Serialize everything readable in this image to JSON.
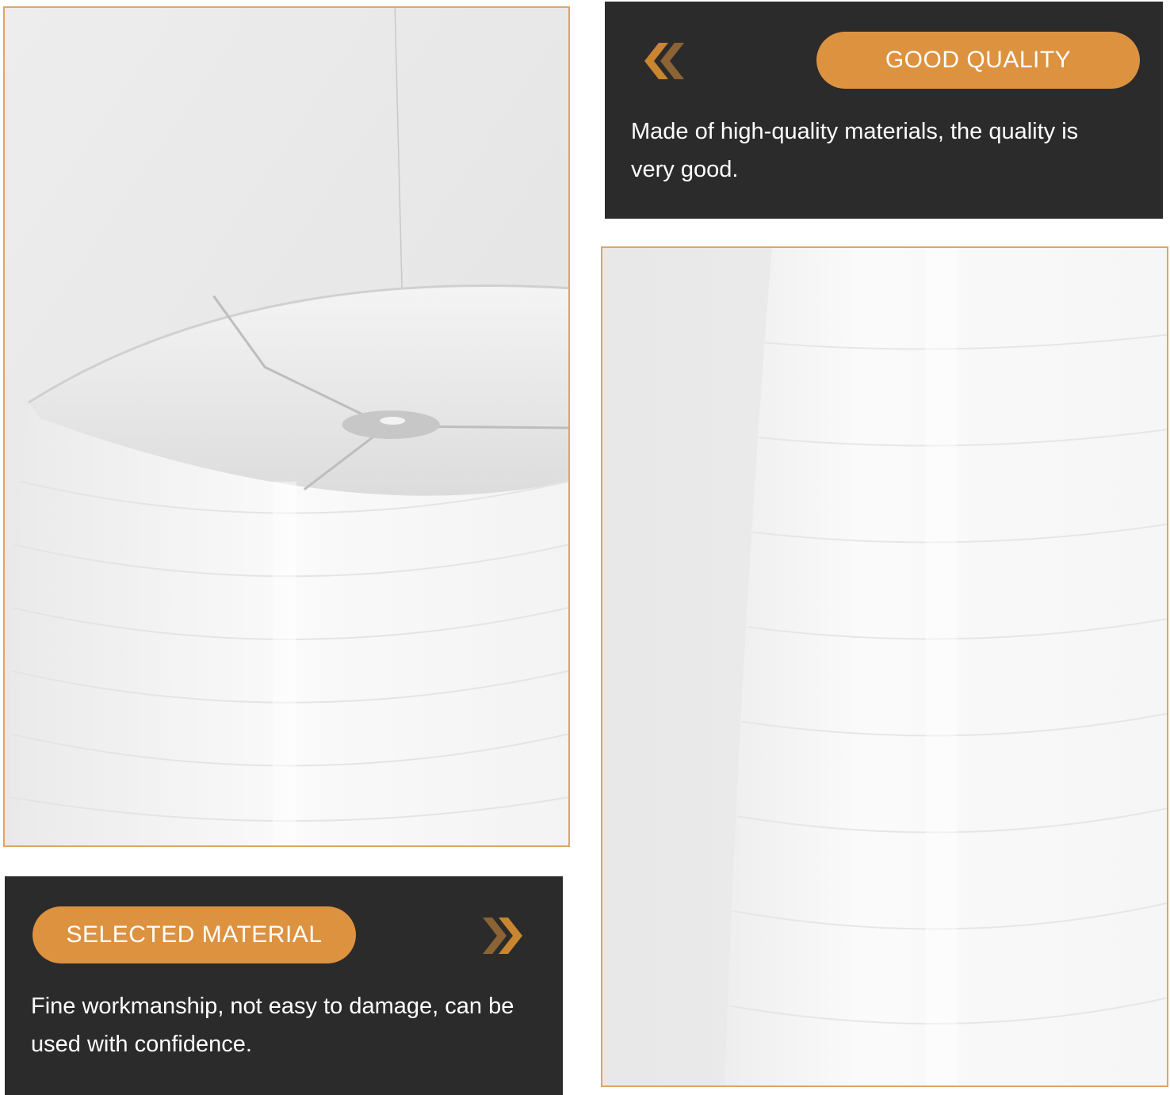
{
  "colors": {
    "accent": "#dd9240",
    "panel": "#2b2b2b",
    "frame": "#e0a464"
  },
  "quality_panel": {
    "badge": "GOOD QUALITY",
    "description": "Made of high-quality materials, the quality is very good.",
    "icon": "double-chevron-left-icon"
  },
  "material_panel": {
    "badge": "SELECTED MATERIAL",
    "description": "Fine workmanship, not easy to damage, can be used with confidence.",
    "icon": "double-chevron-right-icon"
  }
}
